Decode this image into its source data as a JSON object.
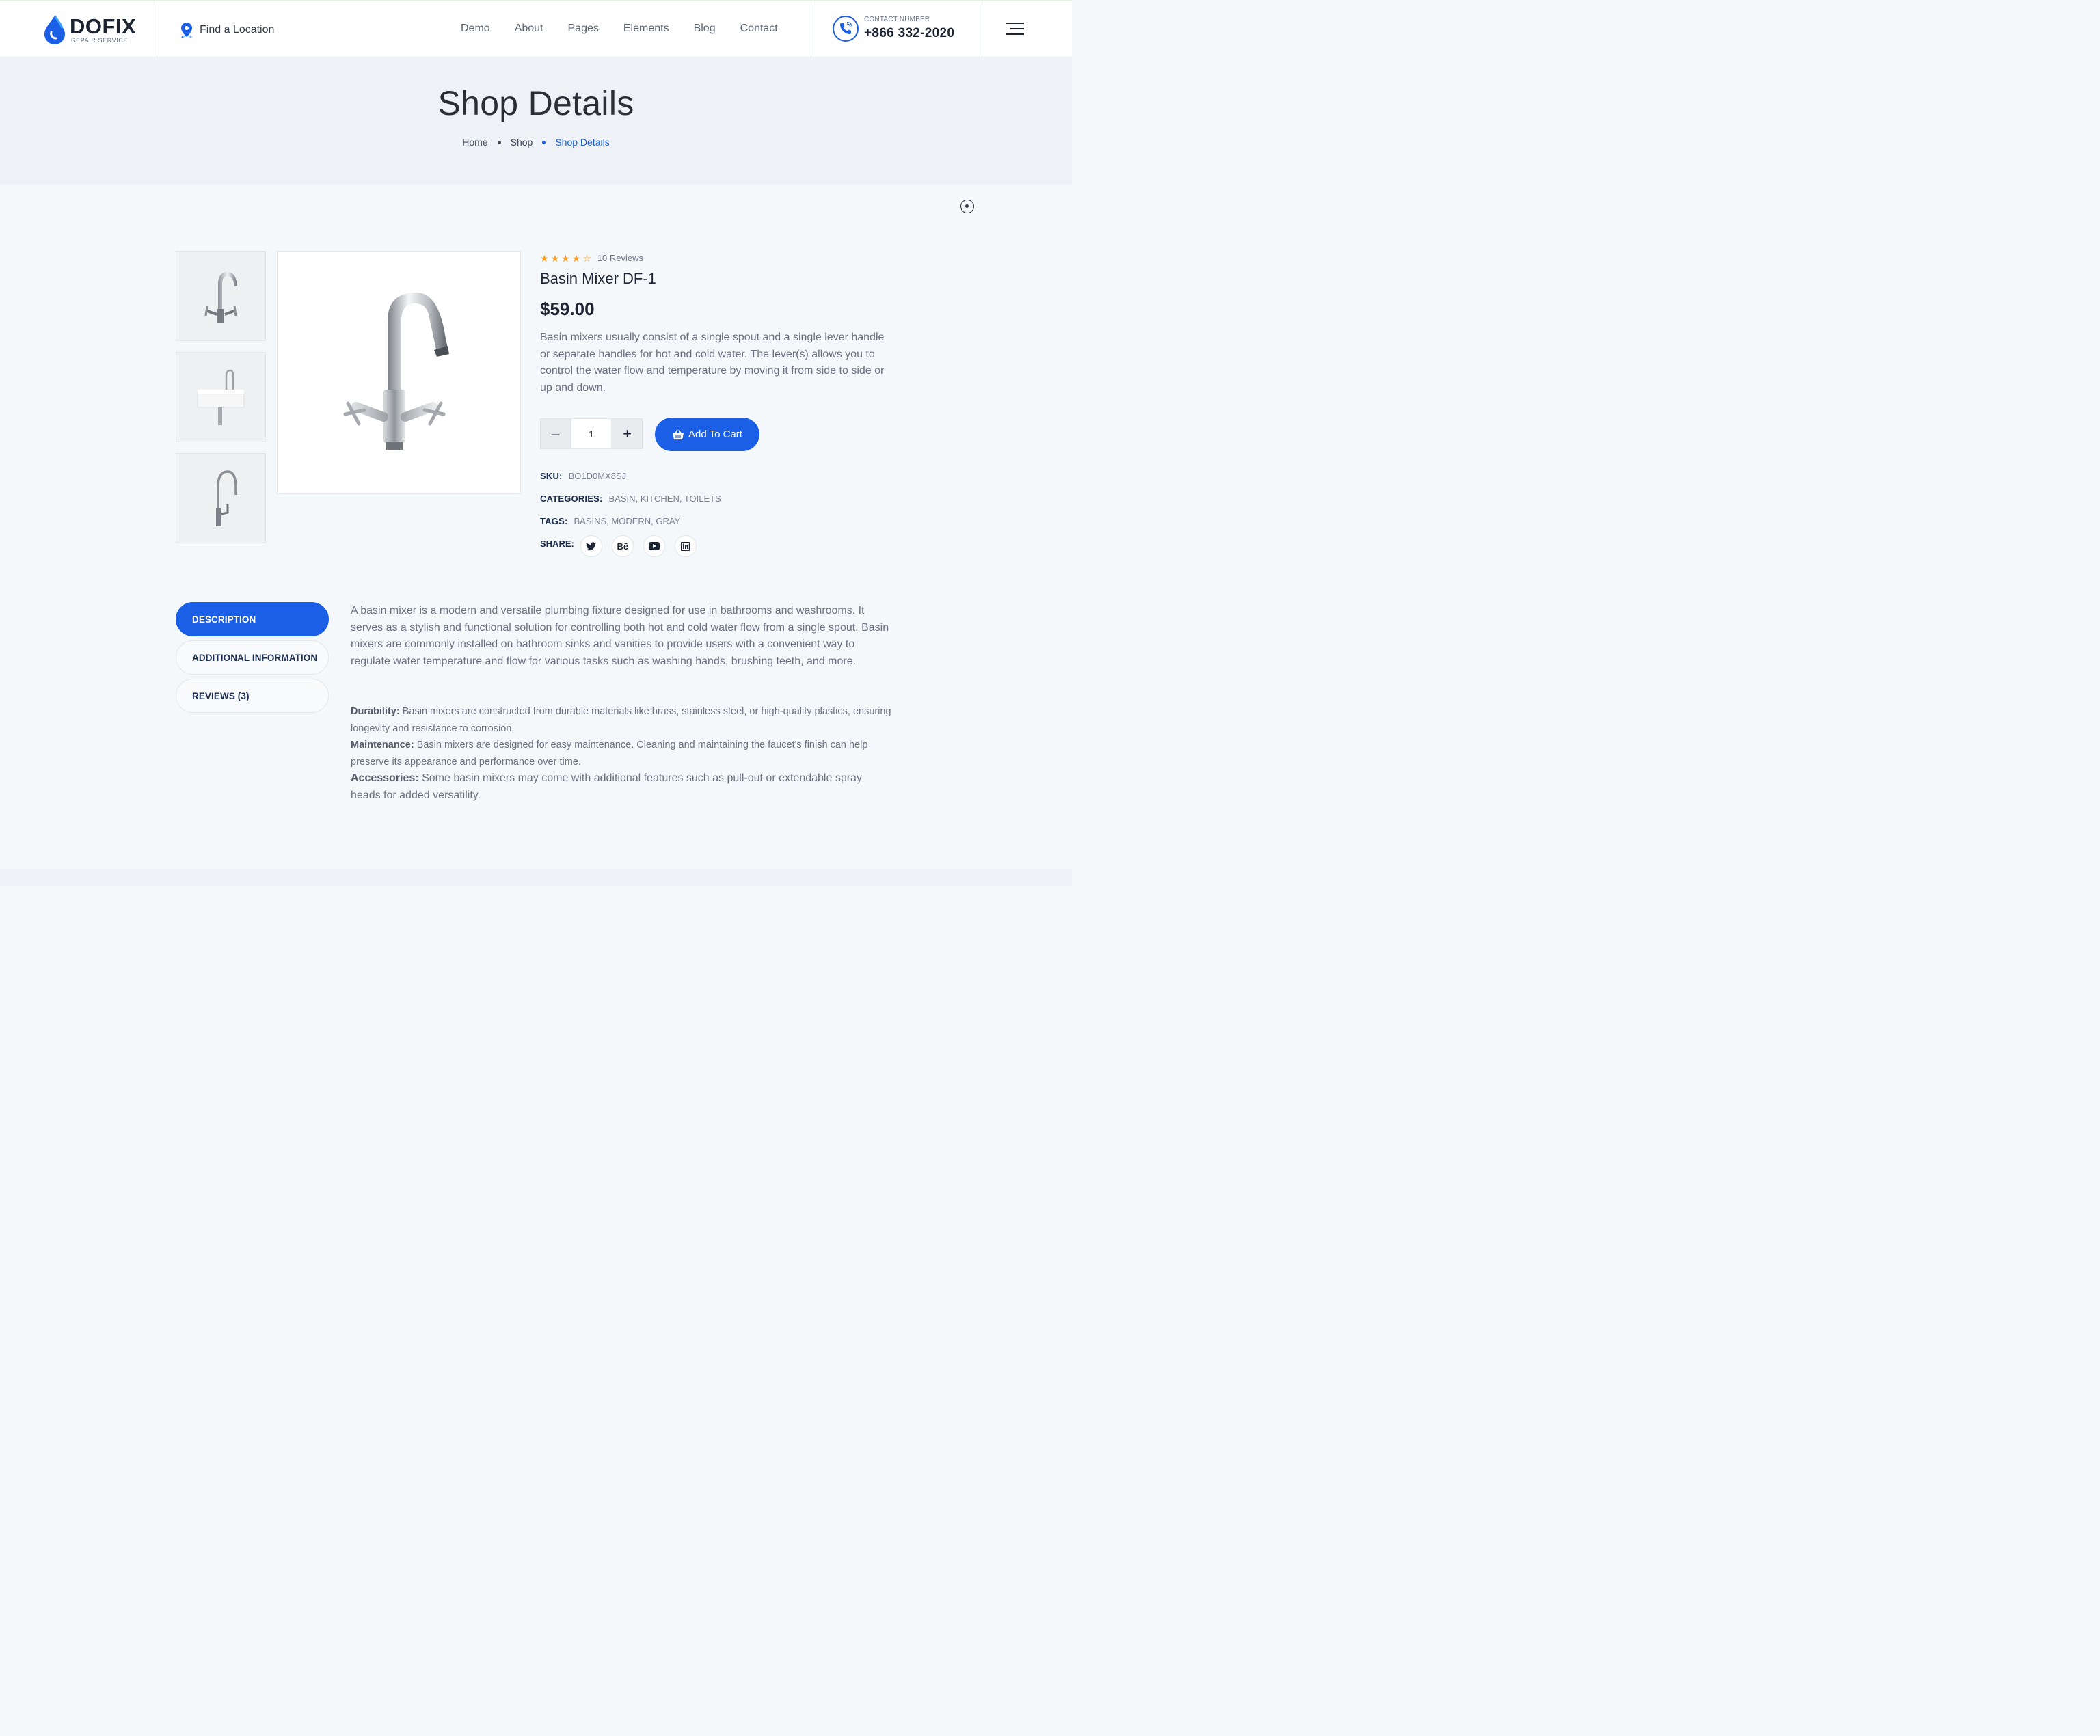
{
  "header": {
    "logo": {
      "name": "DOFIX",
      "tagline": "REPAIR SERVICE"
    },
    "location": "Find a Location",
    "nav": [
      "Demo",
      "About",
      "Pages",
      "Elements",
      "Blog",
      "Contact"
    ],
    "contact": {
      "label": "CONTACT NUMBER",
      "phone": "+866 332-2020"
    }
  },
  "hero": {
    "title": "Shop Details",
    "breadcrumb": [
      "Home",
      "Shop",
      "Shop Details"
    ]
  },
  "product": {
    "rating": {
      "stars": 4,
      "max": 5,
      "reviews_label": "10 Reviews"
    },
    "name": "Basin Mixer DF-1",
    "price": "$59.00",
    "summary": "Basin mixers usually consist of a single spout and a single lever handle or separate handles for hot and cold water. The lever(s) allows you to control the water flow and temperature by moving it from side to side or up and down.",
    "quantity": "1",
    "add_to_cart": "Add To Cart",
    "meta": {
      "sku_label": "SKU:",
      "sku": "BO1D0MX8SJ",
      "categories_label": "CATEGORIES:",
      "categories": "BASIN, KITCHEN, TOILETS",
      "tags_label": "TAGS:",
      "tags": "BASINS, MODERN, GRAY",
      "share_label": "SHARE:"
    },
    "share_icons": [
      "twitter-icon",
      "behance-icon",
      "youtube-icon",
      "linkedin-icon"
    ],
    "behance_text": "Bē"
  },
  "tabs": [
    {
      "label": "DESCRIPTION",
      "active": true
    },
    {
      "label": "ADDITIONAL INFORMATION",
      "active": false
    },
    {
      "label": "REVIEWS (3)",
      "active": false
    }
  ],
  "description": {
    "intro": "A basin mixer is a modern and versatile plumbing fixture designed for use in bathrooms and washrooms. It serves as a stylish and functional solution for controlling both hot and cold water flow from a single spout. Basin mixers are commonly installed on bathroom sinks and vanities to provide users with a convenient way to regulate water temperature and flow for various tasks such as washing hands, brushing teeth, and more.",
    "features": [
      {
        "title": "Durability:",
        "text": " Basin mixers are constructed from durable materials like brass, stainless steel, or high-quality plastics, ensuring longevity and resistance to corrosion."
      },
      {
        "title": "Maintenance:",
        "text": " Basin mixers are designed for easy maintenance. Cleaning and maintaining the faucet's finish can help preserve its appearance and performance over time."
      },
      {
        "title": "Accessories:",
        "text": " Some basin mixers may come with additional features such as pull-out or extendable spray heads for added versatility."
      }
    ]
  },
  "colors": {
    "accent": "#1a5fe6",
    "star": "#f39a1e",
    "text_dark": "#1d2433",
    "text_muted": "#6b7280"
  }
}
